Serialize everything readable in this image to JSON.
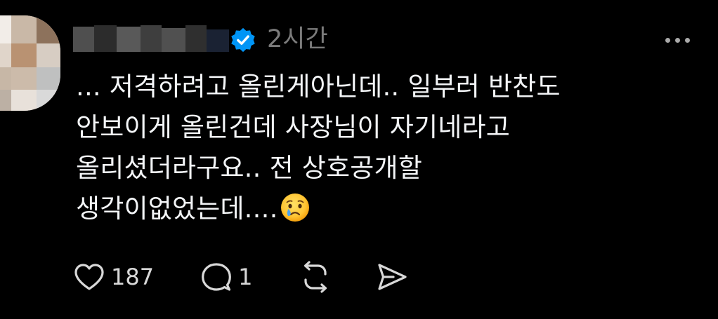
{
  "post": {
    "timestamp": "2시간",
    "lines": [
      "... 저격하려고 올린게아닌데.. 일부러 반찬도",
      "안보이게 올린건데 사장님이 자기네라고",
      "올리셨더라구요.. 전 상호공개할",
      "생각이없었는데...."
    ],
    "trailing_emoji": "crying-face-emoji"
  },
  "actions": {
    "like_count": "187",
    "reply_count": "1"
  },
  "icons": {
    "verified": "verified-badge-icon",
    "more": "more-options-icon",
    "like": "heart-icon",
    "reply": "comment-bubble-icon",
    "repost": "repost-icon",
    "share": "send-icon"
  },
  "colors": {
    "background": "#000000",
    "text": "#f3f5f7",
    "muted": "#7b7b7b",
    "verified": "#0095f6"
  }
}
